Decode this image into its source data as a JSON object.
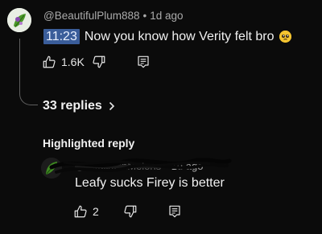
{
  "comment": {
    "author": "@BeautifulPlum888",
    "age": "1d ago",
    "timestamp": "11:23",
    "text": "Now you know how Verity felt bro",
    "emoji_icon": "pleading-face-icon",
    "like_count": "1.6K",
    "icons": {
      "like": "thumbs-up-icon",
      "dislike": "thumbs-down-icon",
      "reply": "reply-comment-icon"
    }
  },
  "replies": {
    "label": "33 replies",
    "chevron": "chevron-right-icon"
  },
  "highlighted": {
    "title": "Highlighted reply",
    "author": "@SkullsOnMelons",
    "age": "1d ago",
    "text": "Leafy sucks Firey is better",
    "like_count": "2",
    "author_obscured": true
  },
  "colors": {
    "background": "#0b0b0b",
    "text_primary": "#f1f1f1",
    "text_secondary": "#aaaaaa",
    "timestamp_highlight": "#3a5d9a"
  }
}
